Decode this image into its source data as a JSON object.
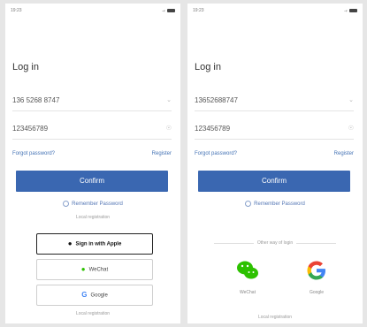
{
  "left": {
    "status_time": "19:23",
    "status_signal": "...ᵢₗ",
    "title": "Log in",
    "phone_value": "136 5268 8747",
    "password_value": "123456789",
    "forgot_label": "Forgot password?",
    "register_label": "Register",
    "confirm_label": "Confirm",
    "remember_label": "Remember Password",
    "local_reg_label": "Local registration",
    "apple_label": "Sign in with Apple",
    "wechat_label": "WeChat",
    "google_label": "Google",
    "bottom_label": "Local registration"
  },
  "right": {
    "status_time": "19:23",
    "status_signal": "...ᵢₗ",
    "title": "Log in",
    "phone_value": "13652688747",
    "password_value": "123456789",
    "forgot_label": "Forgot password?",
    "register_label": "Register",
    "confirm_label": "Confirm",
    "remember_label": "Remember Password",
    "other_label": "Other way of login",
    "wechat_label": "WeChat",
    "google_label": "Google",
    "bottom_label": "Local registration"
  },
  "colors": {
    "accent": "#3a67b1",
    "wechat": "#2dc100",
    "google_blue": "#4285f4"
  }
}
